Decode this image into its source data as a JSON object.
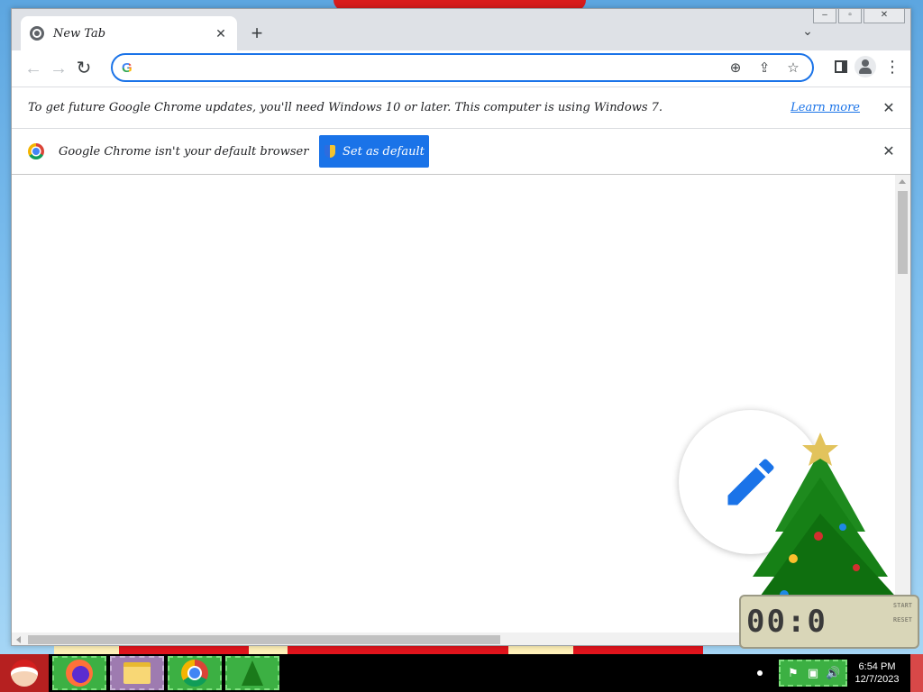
{
  "window": {
    "tab": {
      "title": "New Tab",
      "close_glyph": "✕"
    },
    "new_tab_glyph": "+",
    "tab_search_glyph": "⌄",
    "controls": {
      "minimize": "‒",
      "maximize": "▫",
      "close": "✕"
    }
  },
  "toolbar": {
    "back_glyph": "←",
    "forward_glyph": "→",
    "reload_glyph": "↻",
    "omnibox": {
      "logo": "G",
      "value": "",
      "placeholder": ""
    },
    "zoom_glyph": "⊕",
    "share_glyph": "⇪",
    "bookmark_glyph": "☆",
    "menu_glyph": "⋮"
  },
  "infobars": {
    "update_warning": {
      "message": "To get future Google Chrome updates, you'll need Windows 10 or later. This computer is using Windows 7.",
      "link": "Learn more",
      "close_glyph": "✕"
    },
    "default_browser": {
      "message": "Google Chrome isn't your default browser",
      "button_label": "Set as default",
      "close_glyph": "✕"
    }
  },
  "gadget": {
    "clock_display": "00:0",
    "start_label": "START",
    "reset_label": "RESET"
  },
  "taskbar": {
    "apps": [
      "Firefox",
      "Windows Explorer",
      "Google Chrome",
      "Christmas Tree"
    ],
    "tray_icons": [
      "action-center-flag",
      "network",
      "volume"
    ],
    "clock": {
      "time": "6:54 PM",
      "date": "12/7/2023"
    }
  },
  "colors": {
    "accent": "#1a73e8",
    "tab_strip": "#dee1e6",
    "taskbar": "#000000",
    "taskbar_app_bg": "#3cb043"
  }
}
